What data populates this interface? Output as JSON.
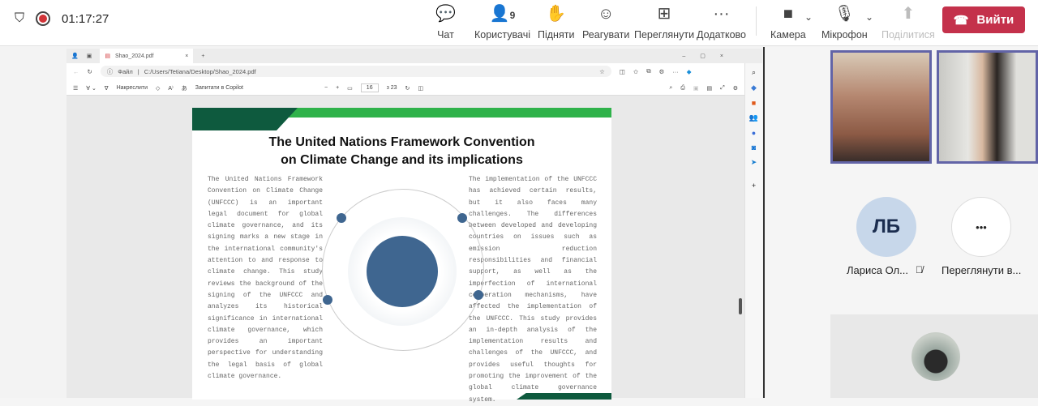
{
  "meeting": {
    "timer": "01:17:27",
    "participants_count": "9"
  },
  "toolbar": [
    {
      "id": "chat",
      "label": "Чат",
      "icon": "chat-icon",
      "glyph": "💬"
    },
    {
      "id": "people",
      "label": "Користувачі",
      "icon": "people-icon",
      "glyph": "👤"
    },
    {
      "id": "raise",
      "label": "Підняти",
      "icon": "raise-hand-icon",
      "glyph": "✋"
    },
    {
      "id": "react",
      "label": "Реагувати",
      "icon": "smile-icon",
      "glyph": "☺"
    },
    {
      "id": "view",
      "label": "Переглянути",
      "icon": "grid-icon",
      "glyph": "⊞"
    },
    {
      "id": "more",
      "label": "Додатково",
      "icon": "more-icon",
      "glyph": "···"
    },
    {
      "id": "camera",
      "label": "Камера",
      "icon": "camera-off-icon",
      "glyph": "■"
    },
    {
      "id": "mic",
      "label": "Мікрофон",
      "icon": "mic-off-icon",
      "glyph": "🎙"
    },
    {
      "id": "share",
      "label": "Поділитися",
      "icon": "share-icon",
      "glyph": "⬆"
    }
  ],
  "leave_label": "Вийти",
  "browser": {
    "tab_title": "Shao_2024.pdf",
    "url_prefix": "Файл",
    "url": "C:/Users/Tetiana/Desktop/Shao_2024.pdf",
    "draw_label": "Накреслити",
    "copilot_label": "Запитати в Copilot",
    "page_current": "16",
    "page_total": "з 23"
  },
  "document": {
    "title_line1": "The United Nations Framework Convention",
    "title_line2": "on Climate Change and its implications",
    "left_text": "The United Nations Framework Convention on Climate Change (UNFCCC) is an important legal document for global climate governance, and its signing marks a new stage in the international community's attention to and response to climate change. This study reviews the background of the signing of the UNFCCC and analyzes its historical significance in international climate governance, which provides an important perspective for understanding the legal basis of global climate governance.",
    "right_text": "The implementation of the UNFCCC has achieved certain results, but it also faces many challenges. The differences between developed and developing countries on issues such as emission reduction responsibilities and financial support, as well as the imperfection of international cooperation mechanisms, have affected the implementation of the UNFCCC. This study provides an in-depth analysis of the implementation results and challenges of the UNFCCC, and provides useful thoughts for promoting the improvement of the global climate governance system."
  },
  "participants": {
    "avatar_initials": "ЛБ",
    "avatar_name": "Лариса Ол...",
    "more_label": "Переглянути в...",
    "more_glyph": "•••"
  }
}
